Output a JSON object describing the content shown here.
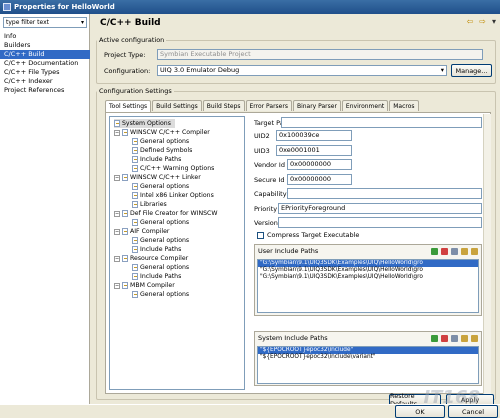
{
  "window": {
    "title": "Properties for HelloWorld"
  },
  "sidebar": {
    "filter_text": "type filter text",
    "items": [
      {
        "label": "Info"
      },
      {
        "label": "Builders"
      },
      {
        "label": "C/C++ Build"
      },
      {
        "label": "C/C++ Documentation"
      },
      {
        "label": "C/C++ File Types"
      },
      {
        "label": "C/C++ Indexer"
      },
      {
        "label": "Project References"
      }
    ]
  },
  "header": {
    "title": "C/C++ Build"
  },
  "active_config": {
    "legend": "Active configuration",
    "project_type_label": "Project Type:",
    "project_type_value": "Symbian Executable Project",
    "config_label": "Configuration:",
    "config_value": "UIQ 3.0 Emulator Debug",
    "manage_label": "Manage..."
  },
  "settings": {
    "legend": "Configuration Settings",
    "tabs": [
      {
        "label": "Tool Settings"
      },
      {
        "label": "Build Settings"
      },
      {
        "label": "Build Steps"
      },
      {
        "label": "Error Parsers"
      },
      {
        "label": "Binary Parser"
      },
      {
        "label": "Environment"
      },
      {
        "label": "Macros"
      }
    ],
    "tree": [
      {
        "label": "System Options"
      },
      {
        "label": "WINSCW C/C++ Compiler"
      },
      {
        "label": "General options"
      },
      {
        "label": "Defined Symbols"
      },
      {
        "label": "Include Paths"
      },
      {
        "label": "C/C++ Warning Options"
      },
      {
        "label": "WINSCW C/C++ Linker"
      },
      {
        "label": "General options"
      },
      {
        "label": "Intel x86 Linker Options"
      },
      {
        "label": "Libraries"
      },
      {
        "label": "Def File Creator for WINSCW"
      },
      {
        "label": "General options"
      },
      {
        "label": "AIF Compiler"
      },
      {
        "label": "General options"
      },
      {
        "label": "Include Paths"
      },
      {
        "label": "Resource Compiler"
      },
      {
        "label": "General options"
      },
      {
        "label": "Include Paths"
      },
      {
        "label": "MBM Compiler"
      },
      {
        "label": "General options"
      }
    ],
    "fields": {
      "target_path_label": "Target Path",
      "target_path_value": "",
      "uid2_label": "UID2",
      "uid2_value": "0x100039ce",
      "uid3_label": "UID3",
      "uid3_value": "0xe0001001",
      "vendor_label": "Vendor Id",
      "vendor_value": "0x00000000",
      "secure_label": "Secure Id",
      "secure_value": "0x00000000",
      "capability_label": "Capability",
      "capability_value": "",
      "priority_label": "Priority",
      "priority_value": "EPriorityForeground",
      "version_label": "Version",
      "version_value": "",
      "compress_label": "Compress Target Executable"
    },
    "user_paths": {
      "label": "User Include Paths",
      "rows": [
        "\"G:\\Symbian\\9.1\\UIQ3SDK\\Examples\\UIQ\\HelloWorld\\gro",
        "\"G:\\Symbian\\9.1\\UIQ3SDK\\Examples\\UIQ\\HelloWorld\\gro",
        "\"G:\\Symbian\\9.1\\UIQ3SDK\\Examples\\UIQ\\HelloWorld\\gro"
      ]
    },
    "system_paths": {
      "label": "System Include Paths",
      "rows": [
        "\"${EPOCROOT}epoc32\\include\"",
        "\"${EPOCROOT}epoc32\\include\\variant\""
      ]
    },
    "restore_label": "Restore Defaults",
    "apply_label": "Apply"
  },
  "footer": {
    "ok_label": "OK",
    "cancel_label": "Cancel"
  },
  "watermark": "IT168"
}
